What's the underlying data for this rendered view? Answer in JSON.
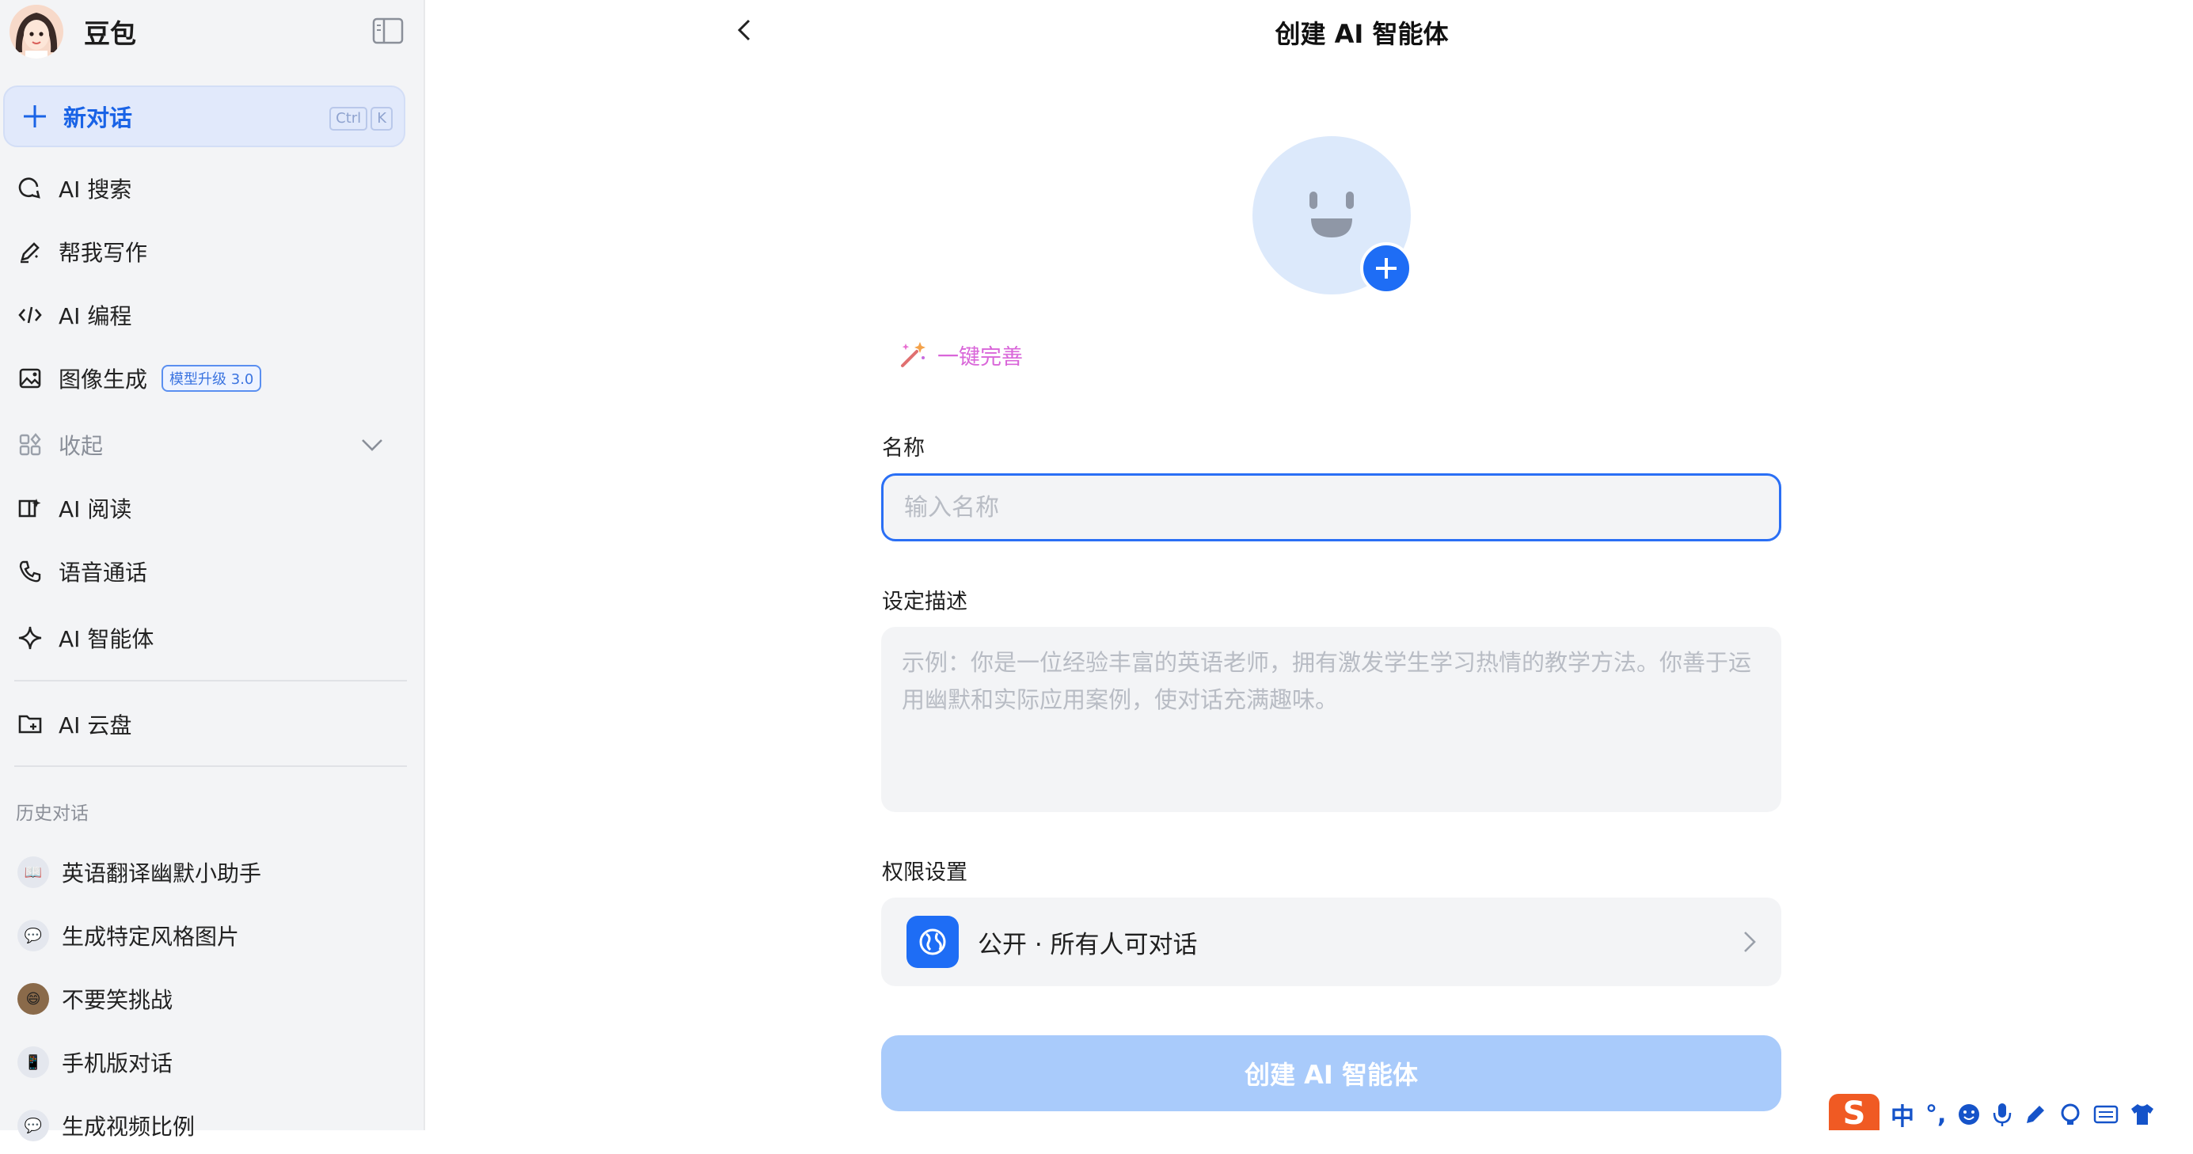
{
  "app": {
    "name": "豆包"
  },
  "sidebar": {
    "new_chat": {
      "label": "新对话",
      "kbd": [
        "Ctrl",
        "K"
      ]
    },
    "items": [
      {
        "label": "AI 搜索",
        "icon": "search-refresh-icon"
      },
      {
        "label": "帮我写作",
        "icon": "pen-edit-icon"
      },
      {
        "label": "AI 编程",
        "icon": "code-icon"
      },
      {
        "label": "图像生成",
        "icon": "image-gen-icon",
        "badge": "模型升级 3.0"
      },
      {
        "label": "收起",
        "icon": "grid-icon"
      },
      {
        "label": "AI 阅读",
        "icon": "book-icon"
      },
      {
        "label": "语音通话",
        "icon": "phone-icon"
      },
      {
        "label": "AI 智能体",
        "icon": "sparkle-icon"
      },
      {
        "label": "AI 云盘",
        "icon": "cloud-folder-icon"
      }
    ],
    "history_title": "历史对话",
    "history": [
      {
        "label": "英语翻译幽默小助手"
      },
      {
        "label": "生成特定风格图片"
      },
      {
        "label": "不要笑挑战"
      },
      {
        "label": "手机版对话"
      },
      {
        "label": "生成视频比例"
      }
    ]
  },
  "main": {
    "title": "创建 AI 智能体",
    "magic_label": "一键完善",
    "name_label": "名称",
    "name_placeholder": "输入名称",
    "desc_label": "设定描述",
    "desc_placeholder": "示例：你是一位经验丰富的英语老师，拥有激发学生学习热情的教学方法。你善于运用幽默和实际应用案例，使对话充满趣味。",
    "perm_label": "权限设置",
    "perm_value": "公开 · 所有人可对话",
    "create_button": "创建 AI 智能体"
  },
  "ime": {
    "logo": "S",
    "mode": "中",
    "punct": "°,"
  },
  "colors": {
    "accent": "#1e6df5",
    "sidebar_bg": "#f3f4f6",
    "create_disabled": "#a9cbfb",
    "magic": "#d966d9"
  }
}
